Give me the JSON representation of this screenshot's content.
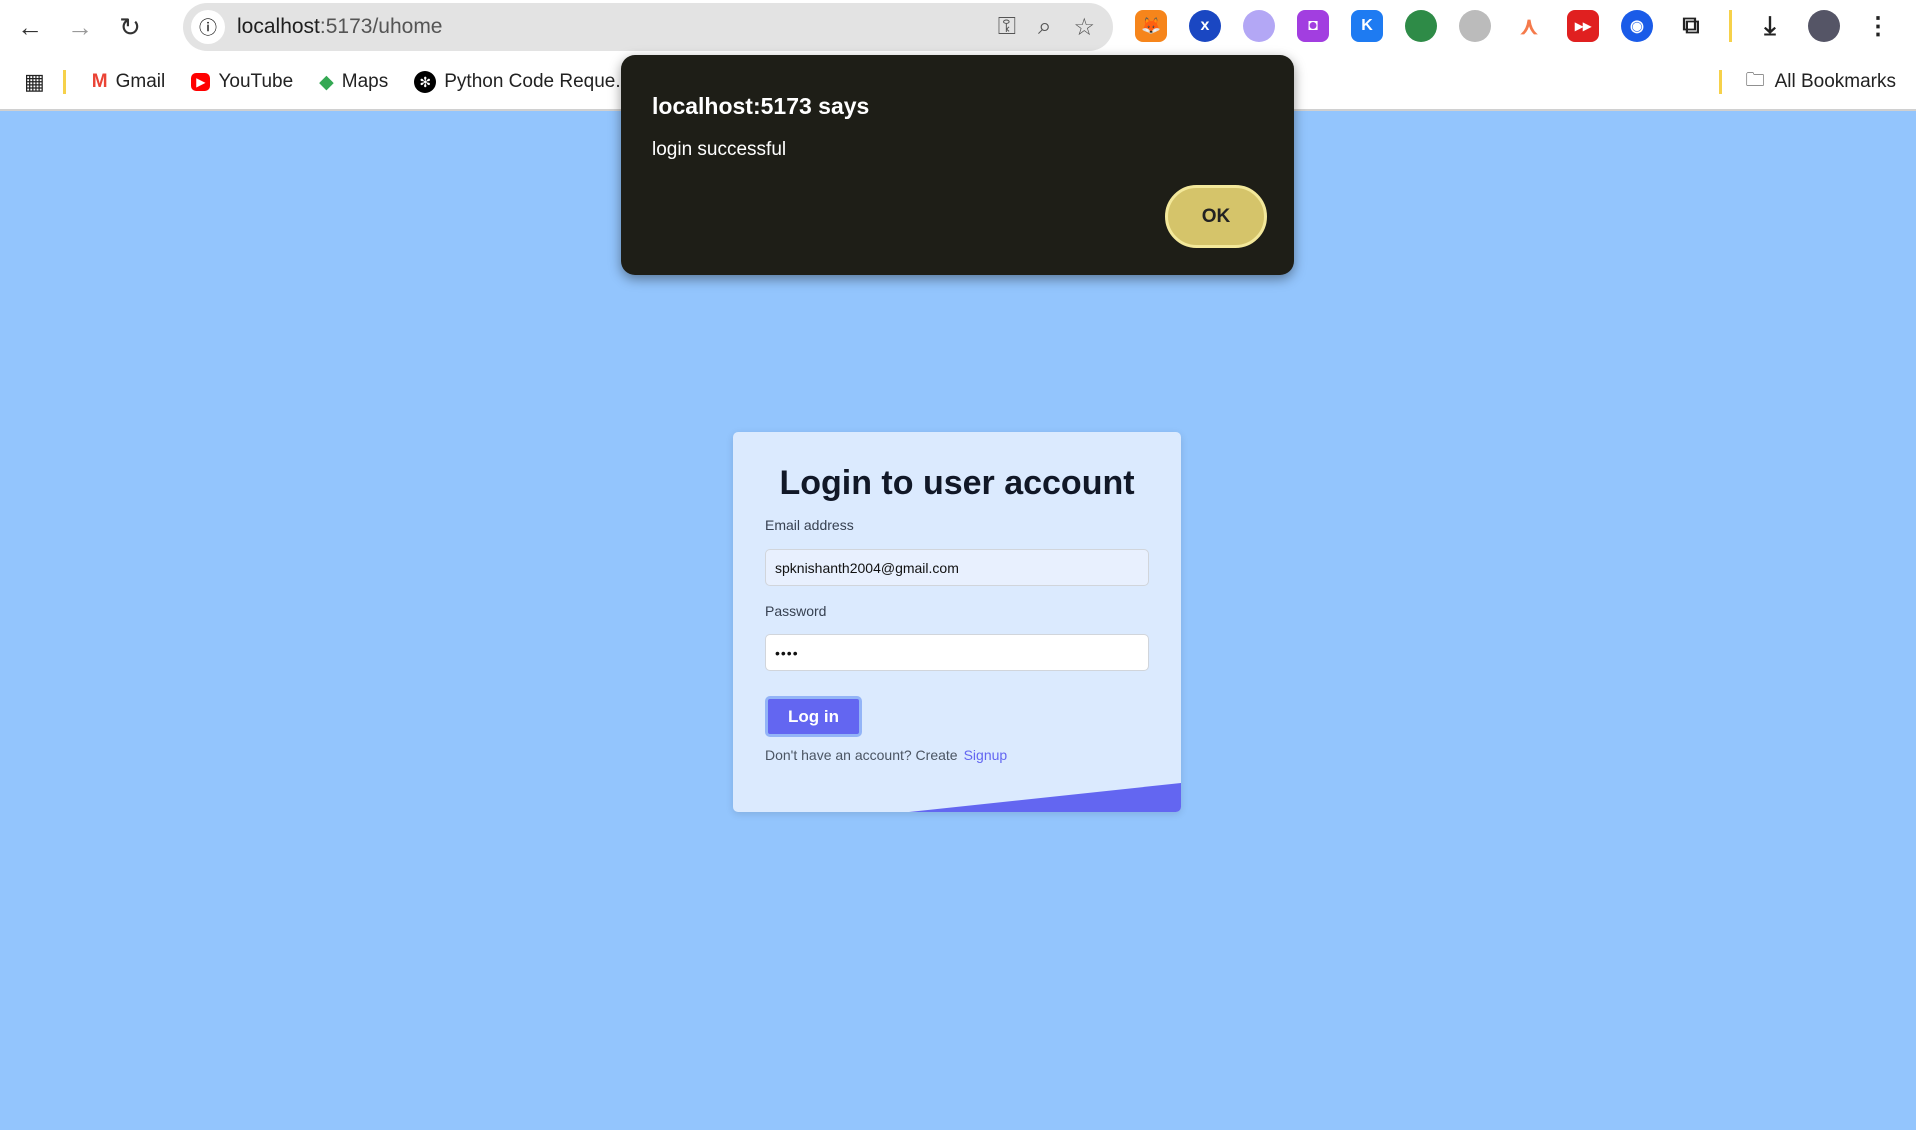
{
  "browser": {
    "url_host": "localhost",
    "url_path": ":5173/uhome",
    "bookmarks": [
      "Gmail",
      "YouTube",
      "Maps",
      "Python Code Reque..."
    ],
    "all_bookmarks": "All Bookmarks"
  },
  "login": {
    "title": "Login to user account",
    "email_label": "Email address",
    "email_value": "spknishanth2004@gmail.com",
    "password_label": "Password",
    "password_value": "••••",
    "login_button": "Log in",
    "footer_text": "Don't have an account? Create",
    "signup_link": "Signup",
    "accent": "#6366f1"
  },
  "alert": {
    "title": "localhost:5173 says",
    "message": "login successful",
    "ok_button": "OK"
  }
}
